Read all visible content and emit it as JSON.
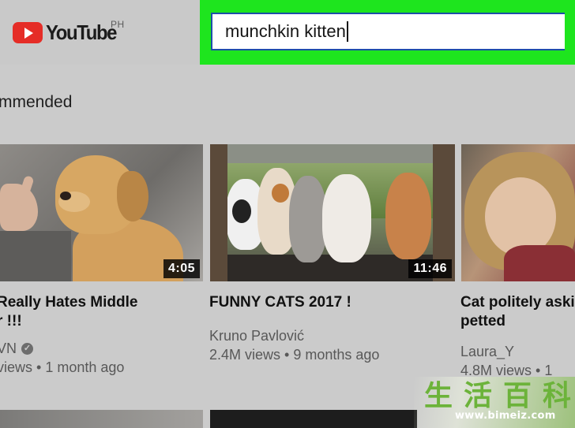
{
  "header": {
    "logo_text": "YouTube",
    "region": "PH",
    "search": {
      "value": "munchkin kitten"
    }
  },
  "section": {
    "title": "mmended"
  },
  "videos": [
    {
      "duration": "4:05",
      "title_line1": "Really Hates Middle",
      "title_line2": "r !!!",
      "channel": "VN",
      "stats": "views • 1 month ago"
    },
    {
      "duration": "11:46",
      "title_line1": "FUNNY CATS 2017 !",
      "channel": "Kruno Pavlović",
      "stats": "2.4M views • 9 months ago"
    },
    {
      "title_line1": "Cat politely aski",
      "title_line2": "petted",
      "channel": "Laura_Y",
      "stats": "4.8M views • 1"
    }
  ],
  "watermark": {
    "chars": [
      "生",
      "活",
      "百",
      "科"
    ],
    "url": "www.bimeiz.com"
  },
  "colors": {
    "highlight": "#1ee51e",
    "search_border": "#1e4fa8",
    "youtube_red": "#e52d27",
    "background": "#cbcbcb"
  }
}
